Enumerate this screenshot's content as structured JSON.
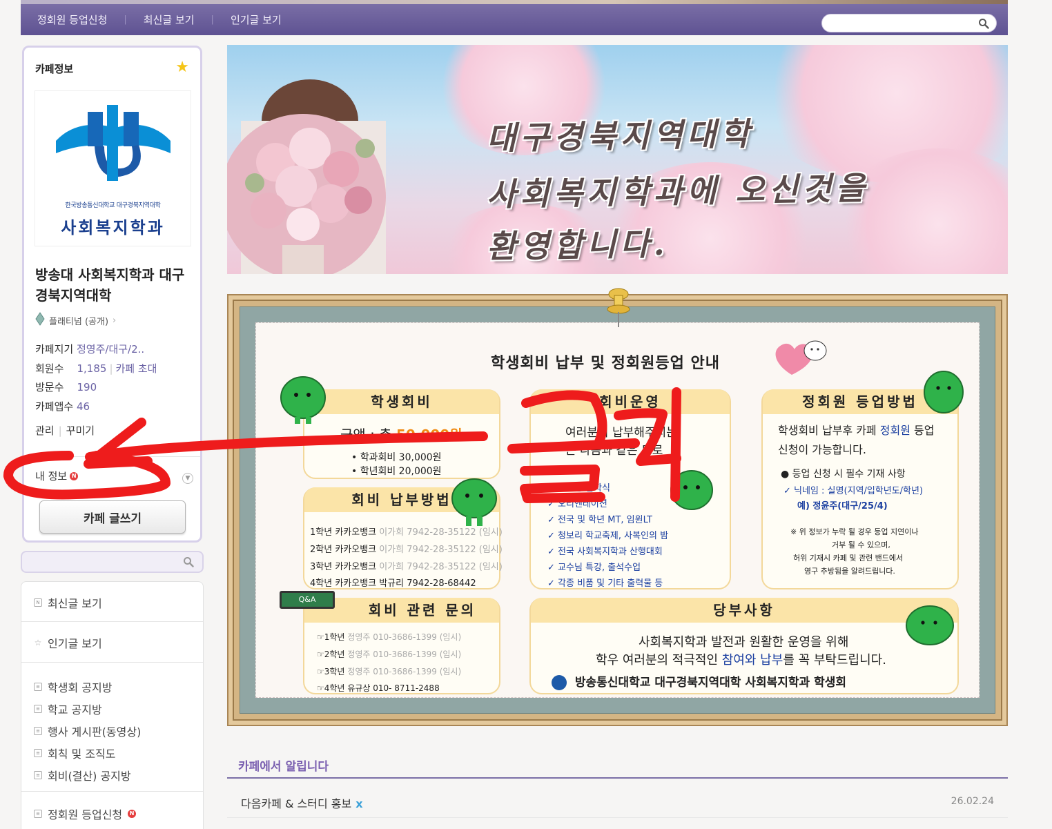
{
  "topnav": {
    "items": [
      "정회원 등업신청",
      "최신글 보기",
      "인기글 보기"
    ],
    "search_placeholder": ""
  },
  "cafe_info": {
    "title": "카페정보",
    "logo_subtitle": "한국방송통신대학교 대구경북지역대학",
    "logo_main": "사회복지학과",
    "name": "방송대 사회복지학과 대구경북지역대학",
    "grade": "플래티넘 (공개)",
    "manager_label": "카페지기",
    "manager_value": "정영주/대구/2..",
    "members_label": "회원수",
    "members_value": "1,185",
    "invite_label": "카페 초대",
    "visits_label": "방문수",
    "visits_value": "190",
    "apps_label": "카페앱수",
    "apps_value": "46",
    "admin_link": "관리",
    "decorate_link": "꾸미기",
    "myinfo_label": "내 정보",
    "write_button": "카페 글쓰기"
  },
  "side_menu": {
    "group1": [
      "최신글 보기"
    ],
    "group2": [
      "인기글 보기"
    ],
    "group3": [
      "학생회 공지방",
      "학교 공지방",
      "행사 게시판(동영상)",
      "회칙 및 조직도",
      "회비(결산) 공지방"
    ],
    "group4": [
      "정회원 등업신청"
    ]
  },
  "banner": {
    "line1": "대구경북지역대학",
    "line2": "사회복지학과에  오신것을",
    "line3": "환영합니다."
  },
  "board": {
    "title": "학생회비 납부 및 정회원등업 안내",
    "fee_card": {
      "head": "학생회비",
      "amount_label": "금액 : 총",
      "amount_value": "50,000원",
      "line1": "• 학과회비 30,000원",
      "line2": "• 학년회비 20,000원"
    },
    "pay_card": {
      "head": "회비 납부방법",
      "rows": [
        {
          "year": "1학년 카카오뱅크",
          "acct": "이가희 7942-28-35122 (임시)",
          "muted": true
        },
        {
          "year": "2학년 카카오뱅크",
          "acct": "이가희 7942-28-35122 (임시)",
          "muted": true
        },
        {
          "year": "3학년 카카오뱅크",
          "acct": "이가희 7942-28-35122 (임시)",
          "muted": true
        },
        {
          "year": "4학년 카카오뱅크",
          "acct": "박규리 7942-28-68442",
          "muted": false
        }
      ]
    },
    "use_card": {
      "head": "회비운영",
      "intro1": "여러분이 납부해주시는",
      "intro2": "는 다음과 같은 도로",
      "items": [
        "✓ 신입생 입학식",
        "✓ 오리엔테이션",
        "✓ 전국 및 학년 MT, 임원LT",
        "✓ 청보리 학교축제, 사복인의 밤",
        "✓ 전국 사회복지학과 산행대회",
        "✓ 교수님 특강, 출석수업",
        "✓ 각종 비품 및 기타 출력물 등"
      ]
    },
    "upgrade_card": {
      "head": "정회원 등업방법",
      "line1_a": "학생회비 납부후 카페",
      "line1_b": "정회원",
      "line1_c": "등업",
      "line2": "신청이 가능합니다.",
      "bullet": "● 등업 신청 시 필수 기재 사항",
      "nick": "✓ 닉네임 : 실명(지역/입학년도/학년)",
      "example": "예) 정윤주(대구/25/4)",
      "warn1": "※ 위 정보가 누락 될 경우 등업 지연이나",
      "warn2": "거부 될 수 있으며,",
      "warn3": "허위 기재시 카페 및 관련 밴드에서",
      "warn4": "영구 추방됨을 알려드립니다."
    },
    "inquiry_card": {
      "head": "회비 관련 문의",
      "qa": "Q&A",
      "rows": [
        {
          "year": "☞1학년",
          "contact": "정영주 010-3686-1399 (임시)",
          "muted": true
        },
        {
          "year": "☞2학년",
          "contact": "정영주 010-3686-1399 (임시)",
          "muted": true
        },
        {
          "year": "☞3학년",
          "contact": "정영주 010-3686-1399 (임시)",
          "muted": true
        },
        {
          "year": "☞4학년",
          "contact": "유규상 010- 8711-2488",
          "muted": false
        }
      ]
    },
    "request_card": {
      "head": "당부사항",
      "line1": "사회복지학과 발전과 원활한 운영을 위해",
      "line2_a": "학우 여러분의 적극적인",
      "line2_b": "참여와 납부",
      "line2_c": "를 꼭 부탁드립니다.",
      "sign": "방송통신대학교 대구경북지역대학 사회복지학과 학생회"
    }
  },
  "notices": {
    "title": "카페에서 알립니다",
    "rows": [
      {
        "title": "다음카페 & 스터디 홍보",
        "mark": "x",
        "date": "26.02.24"
      }
    ]
  },
  "annotation": {
    "text": "클릭",
    "color": "#ee1c1c"
  }
}
